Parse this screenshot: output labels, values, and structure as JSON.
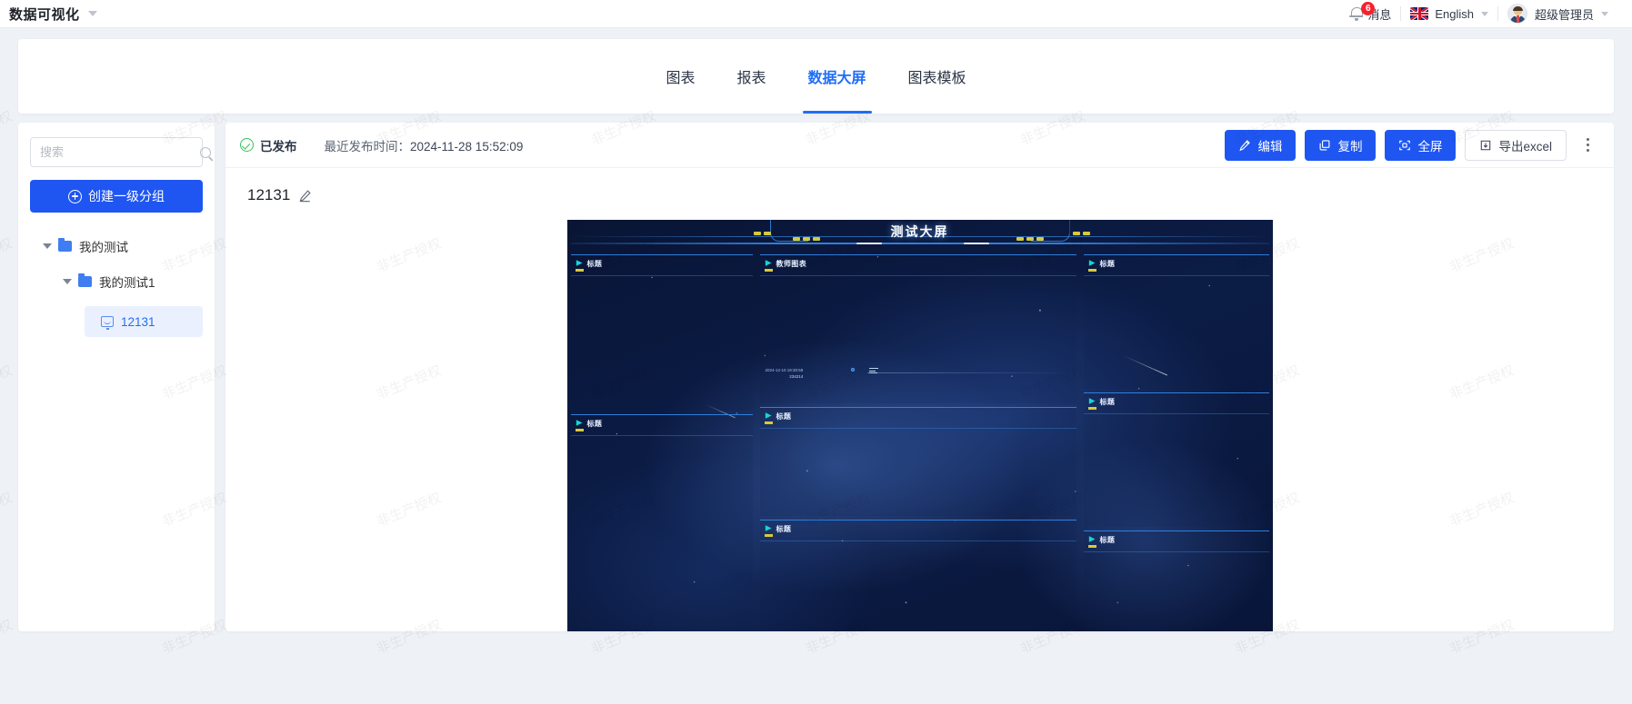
{
  "topbar": {
    "app_title": "数据可视化",
    "app_caret_icon": "chevron-down-icon",
    "messages": {
      "label": "消息",
      "icon": "bell-icon",
      "badge": "6"
    },
    "language": {
      "label": "English",
      "flag": "uk-flag-icon",
      "caret_icon": "chevron-down-icon"
    },
    "user": {
      "label": "超级管理员",
      "avatar": "user-avatar",
      "caret_icon": "chevron-down-icon"
    }
  },
  "tabs": [
    {
      "label": "图表",
      "active": false
    },
    {
      "label": "报表",
      "active": false
    },
    {
      "label": "数据大屏",
      "active": true
    },
    {
      "label": "图表模板",
      "active": false
    }
  ],
  "sidebar": {
    "search": {
      "placeholder": "搜索",
      "value": "",
      "icon": "search-icon"
    },
    "create_group_button": {
      "label": "创建一级分组",
      "icon": "plus-circle-icon"
    },
    "tree": [
      {
        "label": "我的测试",
        "level": 1,
        "icon": "folder-icon",
        "expanded": true,
        "selected": false
      },
      {
        "label": "我的测试1",
        "level": 2,
        "icon": "folder-icon",
        "expanded": true,
        "selected": false
      },
      {
        "label": "12131",
        "level": 3,
        "icon": "screen-icon",
        "expanded": false,
        "selected": true
      }
    ]
  },
  "content": {
    "status": {
      "label": "已发布",
      "icon": "check-circle-icon"
    },
    "publish_time_label": "最近发布时间：",
    "publish_time_value": "2024-11-28 15:52:09",
    "actions": [
      {
        "label": "编辑",
        "icon": "pencil-icon",
        "style": "primary"
      },
      {
        "label": "复制",
        "icon": "copy-icon",
        "style": "primary"
      },
      {
        "label": "全屏",
        "icon": "fullscreen-icon",
        "style": "primary"
      },
      {
        "label": "导出excel",
        "icon": "download-box-icon",
        "style": "ghost"
      }
    ],
    "more_menu_icon": "more-vertical-icon",
    "board_name": "12131",
    "board_name_edit_icon": "pencil-edit-icon"
  },
  "dashboard": {
    "title": "测试大屏",
    "panels": [
      {
        "title": "标题"
      },
      {
        "title": "教师图表"
      },
      {
        "title": "标题"
      },
      {
        "title": "标题"
      },
      {
        "title": "标题"
      },
      {
        "title": "标题"
      },
      {
        "title": "标题"
      },
      {
        "title": "标题"
      }
    ],
    "chart_note": {
      "datetime": "2024-12-10 19:30:58",
      "value": "234214"
    }
  },
  "watermark": {
    "text": "非生产授权"
  },
  "colors": {
    "accent": "#1f56f2",
    "tab_active": "#1f6ef7",
    "success": "#35c25b",
    "badge": "#f5222d",
    "page_bg": "#eef2f7",
    "dashboard_bg": "#0a1535",
    "panel_border": "#2f7fdd",
    "panel_marker": "#18d6d0",
    "panel_tick": "#d8c93c"
  }
}
